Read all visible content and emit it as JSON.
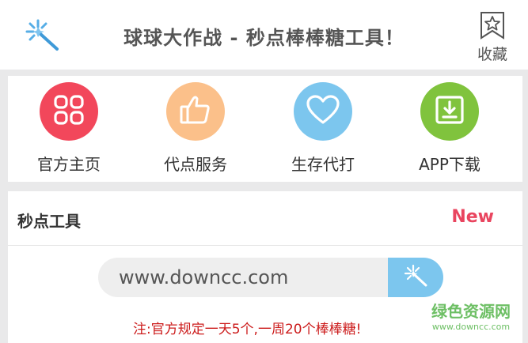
{
  "header": {
    "title": "球球大作战 - 秒点棒棒糖工具！",
    "logo_icon": "magic-wand-icon",
    "favorite_label": "收藏",
    "favorite_icon": "star-bookmark-icon"
  },
  "nav": {
    "items": [
      {
        "label": "官方主页",
        "icon": "grid-icon",
        "color": "#f2475b"
      },
      {
        "label": "代点服务",
        "icon": "thumbs-up-icon",
        "color": "#fbc08a"
      },
      {
        "label": "生存代打",
        "icon": "heart-icon",
        "color": "#7cc6ee"
      },
      {
        "label": "APP下载",
        "icon": "download-icon",
        "color": "#80c33d"
      }
    ]
  },
  "panel": {
    "title": "秒点工具",
    "badge": "New",
    "badge_color": "#e9455f",
    "search_value": "www.downcc.com",
    "search_button_icon": "magic-wand-icon",
    "note": "注:官方规定一天5个,一周20个棒棒糖!"
  },
  "watermark": {
    "main": "绿色资源网",
    "sub": "www.downcc.com"
  }
}
